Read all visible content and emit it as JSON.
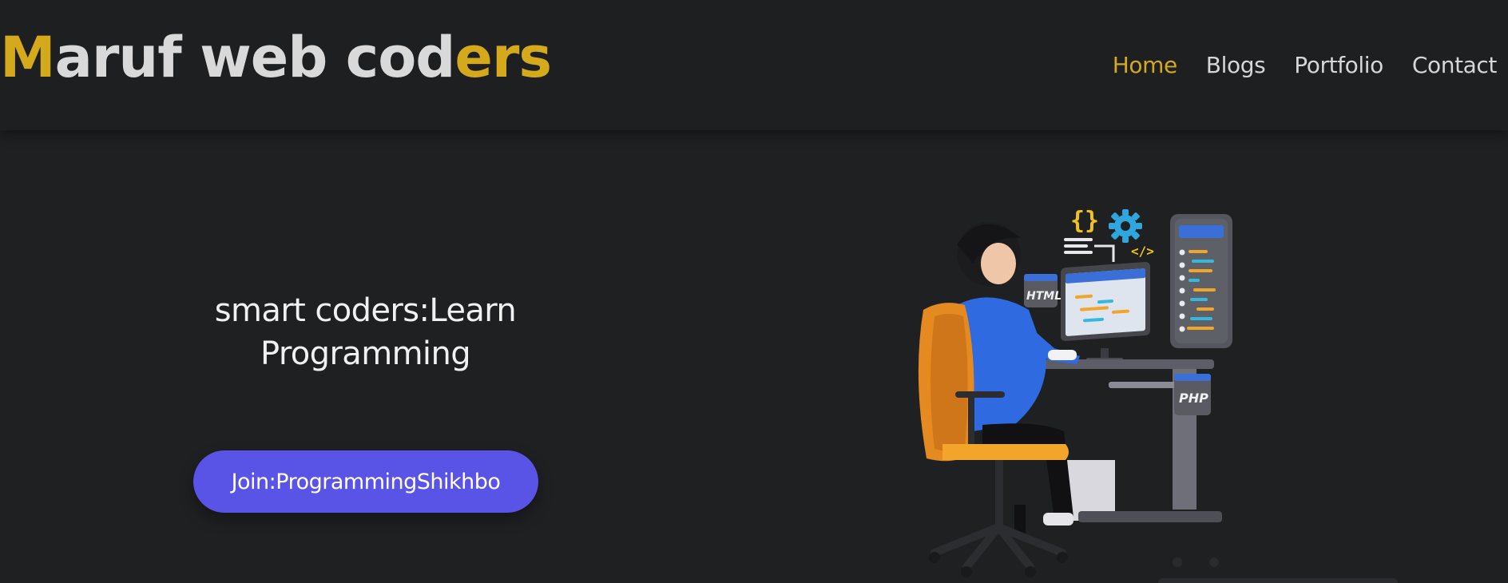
{
  "logo": {
    "part1": "M",
    "part2": "aruf web cod",
    "part3": "ers"
  },
  "nav": {
    "items": [
      {
        "label": "Home",
        "active": true
      },
      {
        "label": "Blogs",
        "active": false
      },
      {
        "label": "Portfolio",
        "active": false
      },
      {
        "label": "Contact",
        "active": false
      }
    ]
  },
  "hero": {
    "headline_line1": "smart coders:Learn",
    "headline_line2": "Programming",
    "cta_label": "Join:ProgrammingShikhbo"
  },
  "illustration": {
    "html_tag": "HTML",
    "php_tag": "PHP",
    "braces_icon": "{}",
    "code_icon": "</>"
  },
  "colors": {
    "background": "#1f2022",
    "accent": "#d4a91c",
    "text": "#d6d6d6",
    "button": "#5a54e6"
  }
}
